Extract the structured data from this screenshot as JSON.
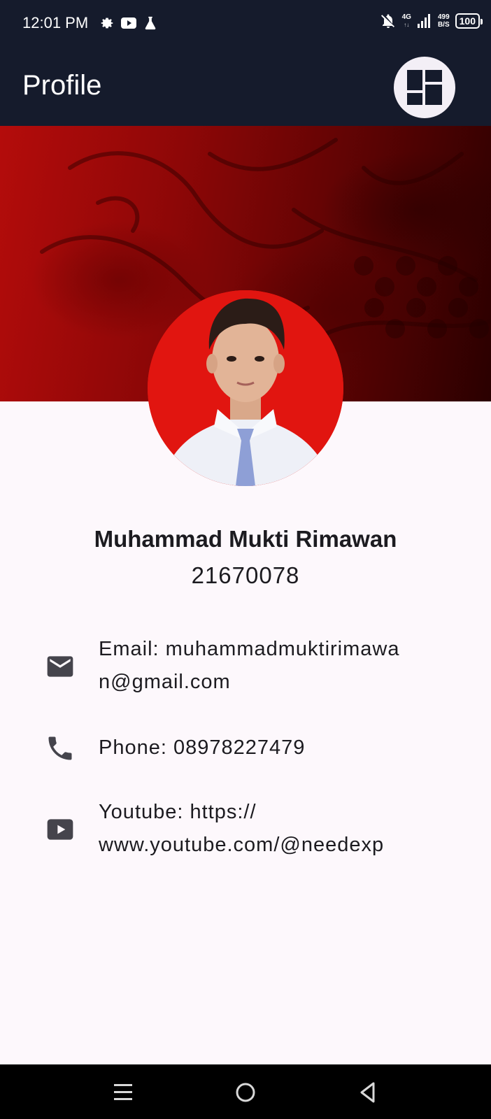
{
  "status_bar": {
    "time": "12:01 PM",
    "network_top": "4G",
    "speed_value": "499",
    "speed_unit": "B/S",
    "battery": "100"
  },
  "app_bar": {
    "title": "Profile",
    "action_icon": "dashboard-layout-icon"
  },
  "profile": {
    "name": "Muhammad Mukti Rimawan",
    "nim": "21670078"
  },
  "contacts": {
    "email": {
      "icon": "email-icon",
      "line1": "Email: muhammadmuktirimawa",
      "line2": "n@gmail.com"
    },
    "phone": {
      "icon": "phone-icon",
      "line1": "Phone: 08978227479"
    },
    "youtube": {
      "icon": "youtube-icon",
      "line1": "Youtube: https://",
      "line2": "www.youtube.com/@needexp"
    }
  },
  "colors": {
    "app_bar_bg": "#151b2c",
    "banner_red": "#b40c0b",
    "avatar_bg": "#e11510",
    "page_bg": "#fdf8fc",
    "icon_color": "#45444c"
  },
  "nav_bar": {
    "menu_icon": "recents-menu-icon",
    "home_icon": "home-circle-icon",
    "back_icon": "back-triangle-icon"
  }
}
